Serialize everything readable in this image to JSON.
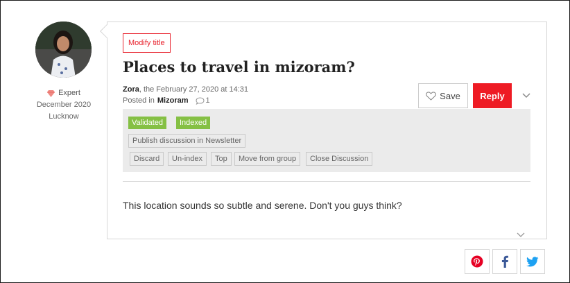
{
  "author": {
    "badge": "Expert",
    "member_since": "December 2020",
    "location": "Lucknow"
  },
  "post": {
    "modify_title_label": "Modify title",
    "title": "Places to travel in mizoram?",
    "author_name": "Zora",
    "date_text": ", the February 27, 2020 at 14:31",
    "posted_in_label": "Posted in",
    "group": "Mizoram",
    "comment_count": "1",
    "body": "This location sounds so subtle and serene. Don't you guys think?"
  },
  "actions": {
    "save_label": "Save",
    "reply_label": "Reply"
  },
  "moderation": {
    "tags": [
      "Validated",
      "Indexed"
    ],
    "newsletter_button": "Publish discussion in Newsletter",
    "buttons": [
      "Discard",
      "Un-index",
      "Top",
      "Move from group",
      "Close Discussion"
    ]
  },
  "share": {
    "icons": [
      "pinterest-icon",
      "facebook-icon",
      "twitter-icon"
    ]
  },
  "colors": {
    "accent": "#ee1b24",
    "tag_green": "#85c044",
    "panel_bg": "#ebebeb",
    "facebook": "#3b5998",
    "twitter": "#1da1f2",
    "pinterest": "#e60023"
  }
}
